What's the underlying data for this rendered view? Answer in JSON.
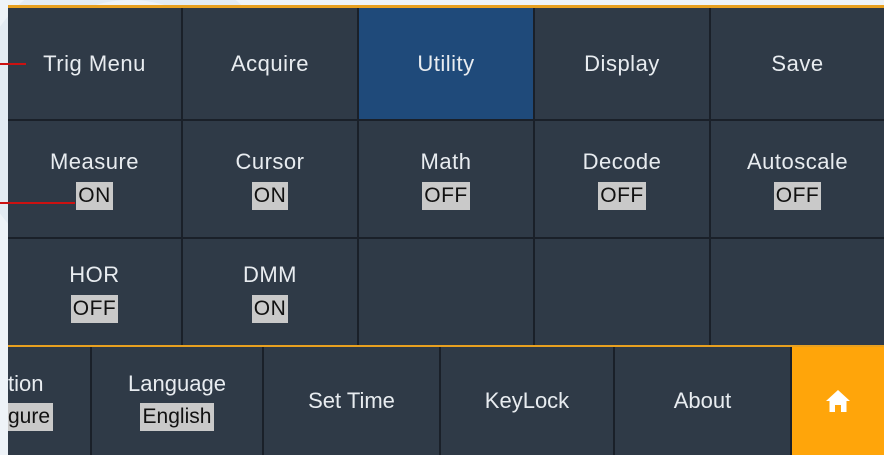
{
  "menu": {
    "row1": [
      {
        "label": "Trig Menu"
      },
      {
        "label": "Acquire"
      },
      {
        "label": "Utility",
        "selected": true
      },
      {
        "label": "Display"
      },
      {
        "label": "Save"
      }
    ],
    "row2": [
      {
        "label": "Measure",
        "value": "ON"
      },
      {
        "label": "Cursor",
        "value": "ON"
      },
      {
        "label": "Math",
        "value": "OFF"
      },
      {
        "label": "Decode",
        "value": "OFF"
      },
      {
        "label": "Autoscale",
        "value": "OFF"
      }
    ],
    "row3": [
      {
        "label": "HOR",
        "value": "OFF"
      },
      {
        "label": "DMM",
        "value": "ON"
      }
    ]
  },
  "bottom_bar": {
    "partial": {
      "label": "tion",
      "value": "gure"
    },
    "language": {
      "label": "Language",
      "value": "English"
    },
    "set_time": {
      "label": "Set Time"
    },
    "keylock": {
      "label": "KeyLock"
    },
    "about": {
      "label": "About"
    },
    "home": {
      "icon": "home-icon"
    }
  },
  "colors": {
    "accent": "#ffa50a",
    "selected": "#1f4a7a",
    "callout": "#cc1111"
  }
}
